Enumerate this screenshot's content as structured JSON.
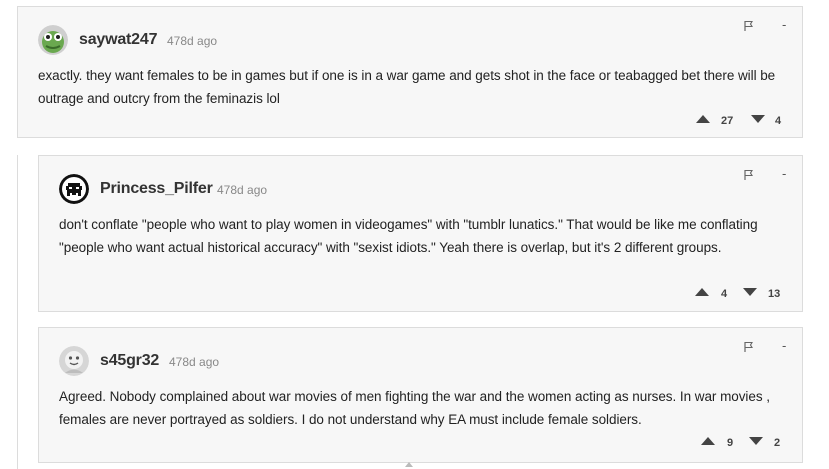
{
  "comments": [
    {
      "username": "saywat247",
      "age": "478d ago",
      "collapse": "-",
      "text": "exactly. they want females to be in games but if one is in a war game and gets shot in the face or teabagged bet there will be outrage and outcry from the feminazis lol",
      "upvotes": "27",
      "downvotes": "4",
      "avatar_icon": "frog-avatar-icon"
    },
    {
      "username": "Princess_Pilfer",
      "age": "478d ago",
      "collapse": "-",
      "text": "don't conflate \"people who want to play women in videogames\" with \"tumblr lunatics.\" That would be like me conflating \"people who want actual historical accuracy\" with \"sexist idiots.\" Yeah there is overlap, but it's 2 different groups.",
      "upvotes": "4",
      "downvotes": "13",
      "avatar_icon": "space-invader-avatar-icon"
    },
    {
      "username": "s45gr32",
      "age": "478d ago",
      "collapse": "-",
      "text": "Agreed. Nobody complained about war movies of men fighting the war and the women acting as nurses. In war movies , females are never portrayed as soldiers. I do not understand why EA must include female soldiers.",
      "upvotes": "9",
      "downvotes": "2",
      "avatar_icon": "default-face-avatar-icon"
    }
  ],
  "colors": {
    "card_bg": "#f7f7f7",
    "border": "#dcdcdc",
    "icon": "#444444"
  }
}
